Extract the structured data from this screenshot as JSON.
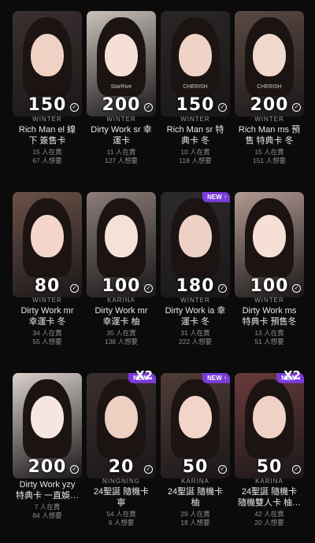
{
  "cards": [
    {
      "price": "150",
      "brand": "WINTER",
      "title1": "Rich Man el 線",
      "title2": "下 簽售卡",
      "selling": "15 人在賣",
      "wanting": "67 人想要",
      "new": false,
      "mult": "",
      "overlay": ""
    },
    {
      "price": "200",
      "brand": "WINTER",
      "title1": "Dirty Work sr 幸",
      "title2": "運卡",
      "selling": "11 人在賣",
      "wanting": "127 人想要",
      "new": false,
      "mult": "",
      "overlay": "StarRive"
    },
    {
      "price": "150",
      "brand": "WINTER",
      "title1": "Rich Man sr 特",
      "title2": "典卡 冬",
      "selling": "10 人在賣",
      "wanting": "118 人想要",
      "new": false,
      "mult": "",
      "overlay": "CHERISH"
    },
    {
      "price": "200",
      "brand": "WINTER",
      "title1": "Rich Man ms 預",
      "title2": "售 特典卡 冬",
      "selling": "15 人在賣",
      "wanting": "151 人想要",
      "new": false,
      "mult": "",
      "overlay": "CHERISH"
    },
    {
      "price": "80",
      "brand": "WINTER",
      "title1": "Dirty Work mr",
      "title2": "幸運卡 冬",
      "selling": "34 人在賣",
      "wanting": "55 人想要",
      "new": false,
      "mult": "",
      "overlay": ""
    },
    {
      "price": "100",
      "brand": "KARINA",
      "title1": "Dirty Work mr",
      "title2": "幸運卡 柚",
      "selling": "35 人在賣",
      "wanting": "138 人想要",
      "new": false,
      "mult": "",
      "overlay": ""
    },
    {
      "price": "180",
      "brand": "WINTER",
      "title1": "Dirty Work ia 幸",
      "title2": "運卡 冬",
      "selling": "31 人在賣",
      "wanting": "222 人想要",
      "new": true,
      "mult": "",
      "overlay": ""
    },
    {
      "price": "100",
      "brand": "WINTER",
      "title1": "Dirty Work ms",
      "title2": "特典卡 預售冬",
      "selling": "13 人在賣",
      "wanting": "51 人想要",
      "new": false,
      "mult": "",
      "overlay": ""
    },
    {
      "price": "200",
      "brand": "",
      "title1": "Dirty Work yzy",
      "title2": "特典卡 一直娛…",
      "selling": "7 人在賣",
      "wanting": "84 人想要",
      "new": false,
      "mult": "",
      "overlay": ""
    },
    {
      "price": "20",
      "brand": "NINGNING",
      "title1": "24聖誕 隨機卡",
      "title2": "寧",
      "selling": "54 人在賣",
      "wanting": "6 人想要",
      "new": true,
      "mult": "X2",
      "overlay": ""
    },
    {
      "price": "50",
      "brand": "KARINA",
      "title1": "24聖誕 隨機卡",
      "title2": "柚",
      "selling": "29 人在賣",
      "wanting": "18 人想要",
      "new": true,
      "mult": "",
      "overlay": ""
    },
    {
      "price": "50",
      "brand": "KARINA",
      "title1": "24聖誕 隨機卡",
      "title2": "隨機雙人卡 柚…",
      "selling": "42 人在賣",
      "wanting": "20 人想要",
      "new": true,
      "mult": "X2",
      "overlay": ""
    }
  ],
  "badge_new": "NEW ↑",
  "colors": {
    "bg": "#0b0b0c",
    "accent": "#7a3bd8"
  }
}
